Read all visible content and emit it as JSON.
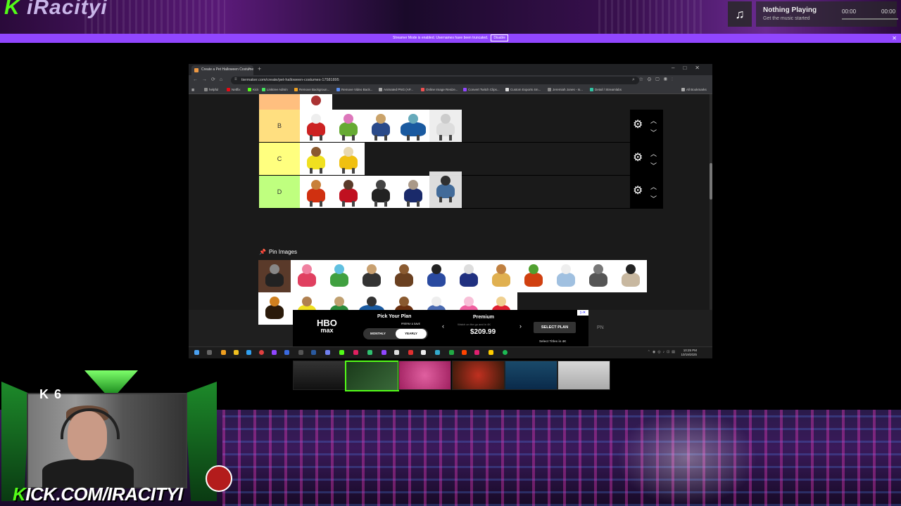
{
  "overlay": {
    "brand_prefix": "K",
    "brand_name": "iRacityi",
    "now_playing_title": "Nothing Playing",
    "now_playing_sub": "Get the music started",
    "time_current": "00:00",
    "time_total": "00:00",
    "banner_text": "Streamer Mode is enabled. Usernames have been truncated.",
    "banner_button": "Disable",
    "kick_count": "6",
    "kick_prefix": "K",
    "kick_url": "ICK.COM/IRACITYI"
  },
  "browser": {
    "tab_title": "Create a Pet Halloween Costume",
    "url": "tiermaker.com/create/pet-halloween-costumes-17581895",
    "bookmarks": [
      "helpful",
      "Netflix",
      "Kick",
      "Linktree Admin",
      "Remove Backgroun...",
      "Remove Video Back...",
      "Animated PNG (AP...",
      "Online Image Resize...",
      "Convert Twitch Clips...",
      "Custom Exports 4m...",
      "Jeremiah Jones - Is...",
      "Detail / Streamlabs"
    ],
    "all_bookmarks": "All Bookmarks"
  },
  "tierlist": {
    "tiers": [
      {
        "label": "B",
        "color": "#ffdf80",
        "count": 5
      },
      {
        "label": "C",
        "color": "#ffff7f",
        "count": 2
      },
      {
        "label": "D",
        "color": "#bfff7f",
        "count": 5
      }
    ],
    "pin_label": "Pin Images"
  },
  "ad": {
    "brand": "HBO",
    "brand2": "max",
    "pick_plan": "Pick Your Plan",
    "prepay": "PREPAY & SAVE",
    "monthly": "MONTHLY",
    "yearly": "YEARLY",
    "plan_name": "Premium",
    "plan_sub": "Watch on the go and in 4K",
    "price": "$209.99",
    "select_plan": "SELECT PLAN",
    "select_titles": "Select Titles in 4K",
    "pn": "PN"
  },
  "taskbar": {
    "time": "10:25 PM",
    "date": "10/19/2025"
  }
}
